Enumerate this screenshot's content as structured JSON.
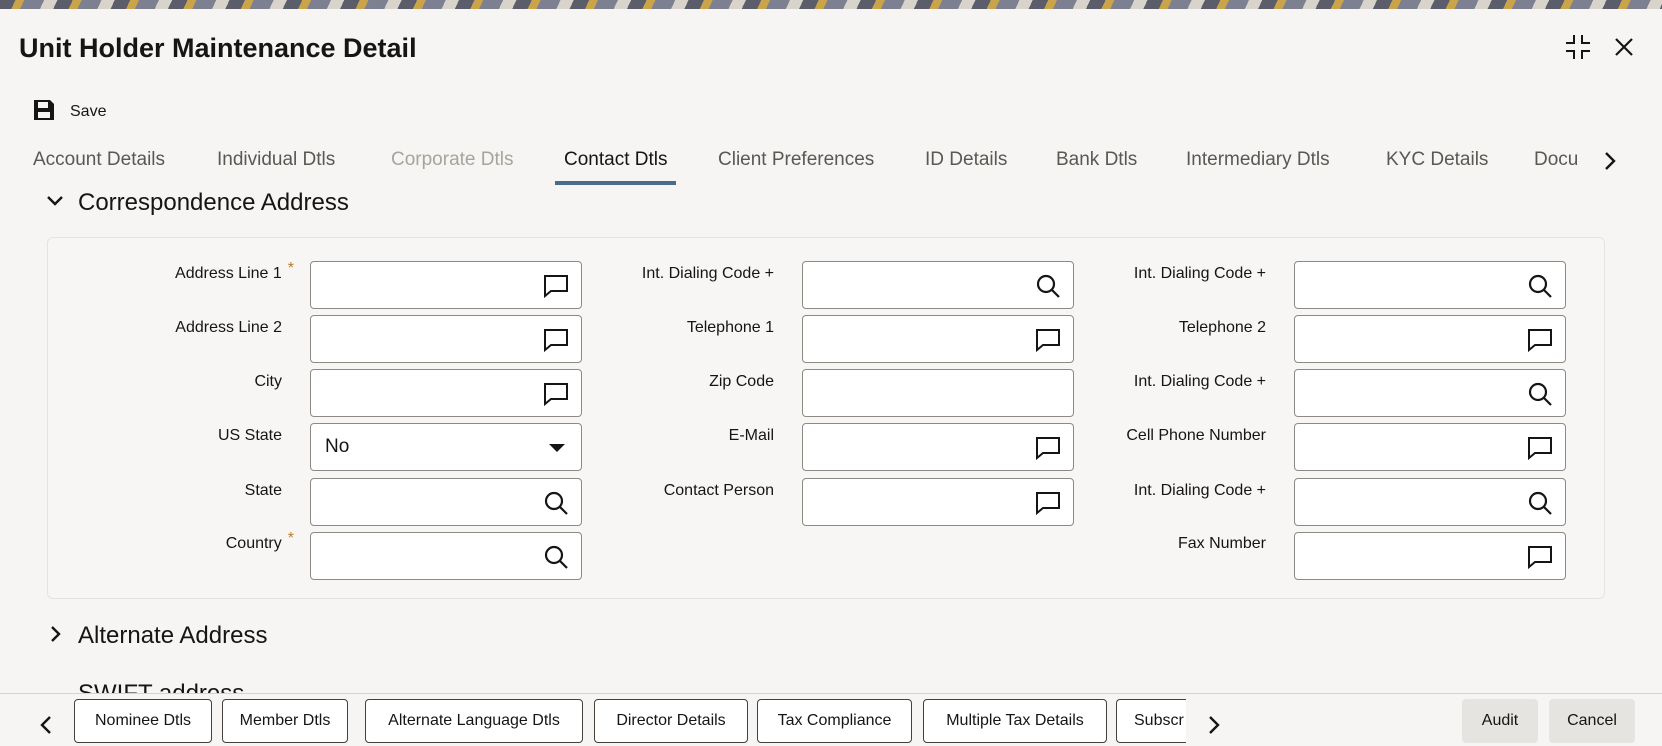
{
  "window": {
    "title": "Unit Holder Maintenance Detail"
  },
  "toolbar": {
    "save_label": "Save"
  },
  "tabs": [
    {
      "label": "Account Details",
      "state": "normal"
    },
    {
      "label": "Individual Dtls",
      "state": "normal"
    },
    {
      "label": "Corporate Dtls",
      "state": "disabled"
    },
    {
      "label": "Contact Dtls",
      "state": "active"
    },
    {
      "label": "Client Preferences",
      "state": "normal"
    },
    {
      "label": "ID Details",
      "state": "normal"
    },
    {
      "label": "Bank Dtls",
      "state": "normal"
    },
    {
      "label": "Intermediary Dtls",
      "state": "normal"
    },
    {
      "label": "KYC Details",
      "state": "normal"
    },
    {
      "label": "Docu",
      "state": "normal"
    }
  ],
  "sections": {
    "correspondence": "Correspondence Address",
    "alternate": "Alternate Address",
    "swift": "SWIFT address"
  },
  "form": {
    "address_line_1": {
      "label": "Address Line 1",
      "value": ""
    },
    "address_line_2": {
      "label": "Address Line 2",
      "value": ""
    },
    "city": {
      "label": "City",
      "value": ""
    },
    "us_state": {
      "label": "US State",
      "value": "No"
    },
    "state": {
      "label": "State",
      "value": ""
    },
    "country": {
      "label": "Country",
      "value": ""
    },
    "int_dialing_code_1": {
      "label": "Int. Dialing Code +",
      "value": ""
    },
    "telephone_1": {
      "label": "Telephone 1",
      "value": ""
    },
    "zip_code": {
      "label": "Zip Code",
      "value": ""
    },
    "email": {
      "label": "E-Mail",
      "value": ""
    },
    "contact_person": {
      "label": "Contact Person",
      "value": ""
    },
    "int_dialing_code_2": {
      "label": "Int. Dialing Code +",
      "value": ""
    },
    "telephone_2": {
      "label": "Telephone 2",
      "value": ""
    },
    "int_dialing_code_3": {
      "label": "Int. Dialing Code +",
      "value": ""
    },
    "cell_phone_number": {
      "label": "Cell Phone Number",
      "value": ""
    },
    "int_dialing_code_4": {
      "label": "Int. Dialing Code +",
      "value": ""
    },
    "fax_number": {
      "label": "Fax Number",
      "value": ""
    },
    "required_marker": "*"
  },
  "bottom_buttons": [
    "Nominee Dtls",
    "Member Dtls",
    "Alternate Language Dtls",
    "Director Details",
    "Tax Compliance",
    "Multiple Tax Details",
    "Subscr"
  ],
  "actions": {
    "audit": "Audit",
    "cancel": "Cancel"
  },
  "colors": {
    "active_tab_underline": "#4a6b8a",
    "required_marker": "#c0792b"
  }
}
